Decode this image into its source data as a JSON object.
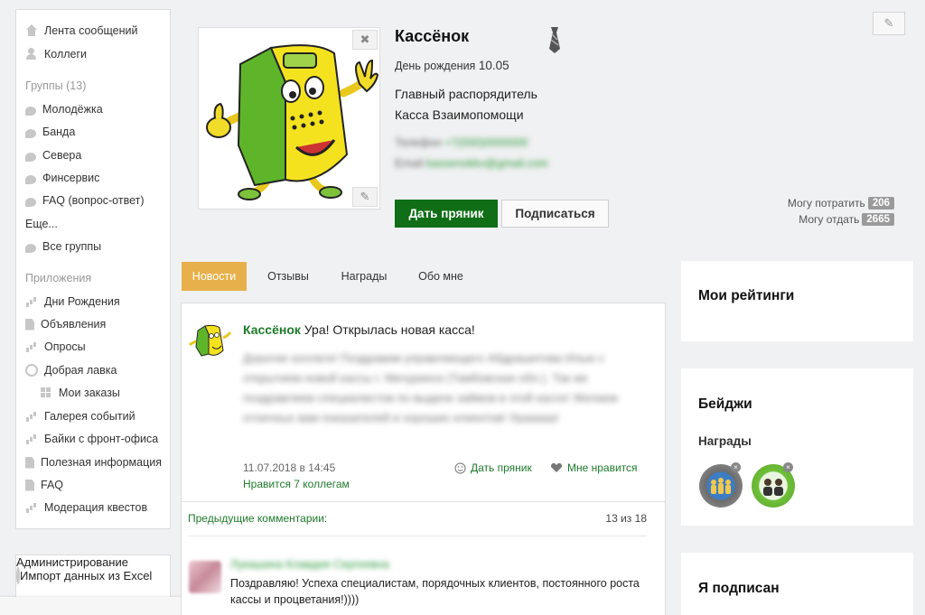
{
  "sidebar": {
    "feed": "Лента сообщений",
    "colleagues": "Коллеги",
    "groups_header": "Группы (13)",
    "groups": [
      "Молодёжка",
      "Банда",
      "Севера",
      "Финсервис",
      "FAQ (вопрос-ответ)"
    ],
    "more": "Еще...",
    "all_groups": "Все группы",
    "apps_header": "Приложения",
    "apps": [
      "Дни Рождения",
      "Объявления",
      "Опросы",
      "Добрая лавка"
    ],
    "my_orders": "Мои заказы",
    "apps2": [
      "Галерея событий",
      "Байки с фронт-офиса",
      "Полезная информация",
      "FAQ",
      "Модерация квестов"
    ],
    "admin_header": "Администрирование",
    "admin_item": "Импорт данных из Excel"
  },
  "profile": {
    "name": "Кассёнок",
    "birthday_label": "День рождения",
    "birthday_value": "10.05",
    "position_line1": "Главный распорядитель",
    "position_line2": "Касса Взаимопомощи",
    "phone_label": "Телефон",
    "phone_value": "+7(000)0000000",
    "email_label": "Email",
    "email_value": "kassenokkv@gmail.com",
    "give_button": "Дать пряник",
    "subscribe_button": "Подписаться",
    "can_spend_label": "Могу потратить",
    "can_spend_value": "206",
    "can_give_label": "Могу отдать",
    "can_give_value": "2665"
  },
  "tabs": [
    "Новости",
    "Отзывы",
    "Награды",
    "Обо мне"
  ],
  "post": {
    "author": "Кассёнок",
    "headline": "Ура! Открылась новая касса!",
    "body": "Дорогие коллеги! Поздравим управляющего Абдрашитова Илью с открытием новой кассы г. Мичуринск (Тамбовская обл.). Так же поздравляем специалистов по выдаче займов в этой кассе! Желаем отличных вам показателей и хороших клиентов! Урааааа!",
    "date": "11.07.2018 в 14:45",
    "likes_text": "Нравится 7 коллегам",
    "give_action": "Дать пряник",
    "like_action": "Мне нравится",
    "prev_comments": "Предыдущие комментарии:",
    "comments_count": "13 из 18",
    "comment_author": "Лукашина Клавдия Сергеевна",
    "comment_text": "Поздравляю! Успеха специалистам, порядочных клиентов, постоянного роста кассы и процветания!))))"
  },
  "widgets": {
    "ratings_title": "Мои рейтинги",
    "badges_title": "Бейджи",
    "awards_label": "Награды",
    "subscribed_title": "Я подписан"
  },
  "colors": {
    "accent_green": "#0f6e16",
    "link_green": "#1e7a2c",
    "tab_active": "#e8b04a"
  }
}
